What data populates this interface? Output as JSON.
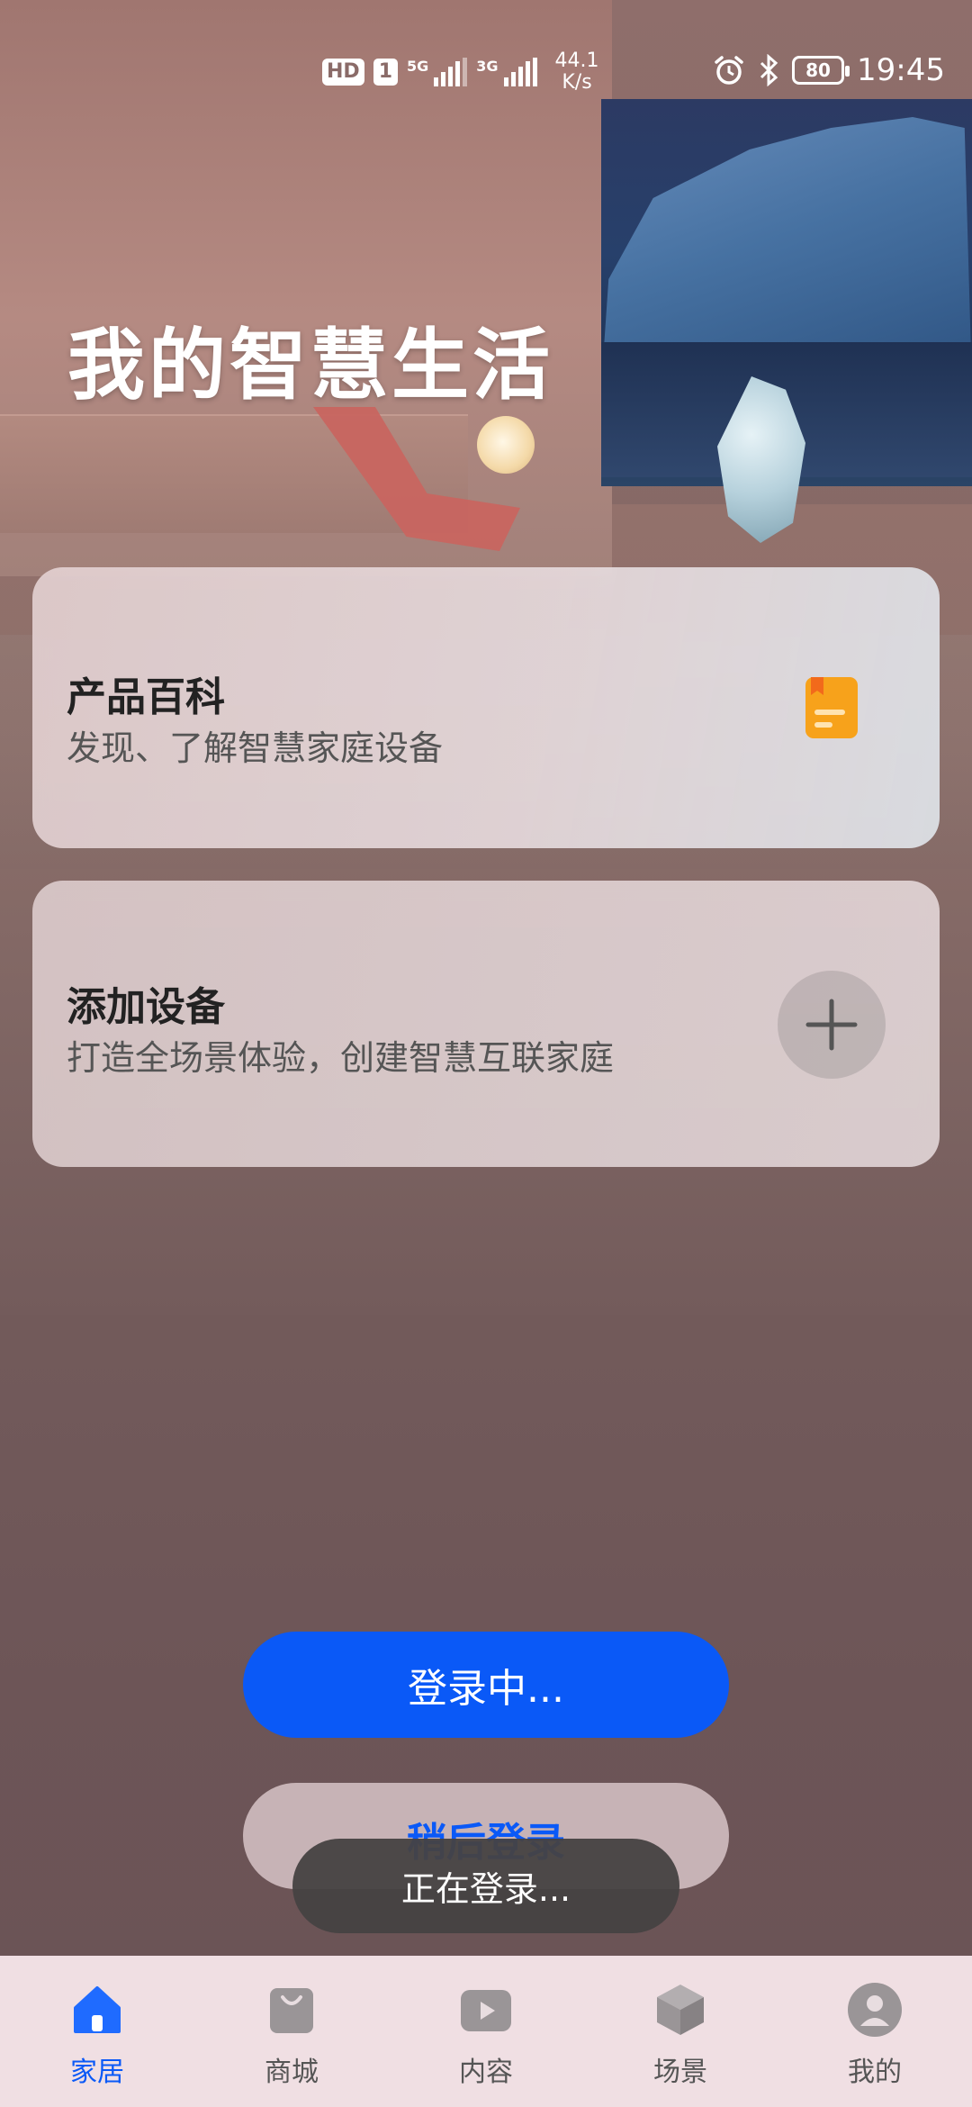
{
  "status_bar": {
    "hd": "HD",
    "sim": "1",
    "net1": "5G",
    "net2": "3G",
    "speed_value": "44.1",
    "speed_unit": "K/s",
    "battery": "80",
    "time": "19:45"
  },
  "hero": {
    "title": "我的智慧生活"
  },
  "cards": [
    {
      "title": "产品百科",
      "subtitle": "发现、了解智慧家庭设备",
      "icon": "book-icon"
    },
    {
      "title": "添加设备",
      "subtitle": "打造全场景体验，创建智慧互联家庭",
      "icon": "plus-icon"
    }
  ],
  "login_button": "登录中...",
  "later_button": "稍后登录",
  "toast": "正在登录...",
  "tabs": [
    {
      "label": "家居",
      "icon": "home-icon",
      "active": true
    },
    {
      "label": "商城",
      "icon": "shopping-bag-icon",
      "active": false
    },
    {
      "label": "内容",
      "icon": "play-icon",
      "active": false
    },
    {
      "label": "场景",
      "icon": "cube-icon",
      "active": false
    },
    {
      "label": "我的",
      "icon": "profile-icon",
      "active": false
    }
  ],
  "colors": {
    "accent": "#0A59F7",
    "book_icon": "#F7A21B"
  }
}
